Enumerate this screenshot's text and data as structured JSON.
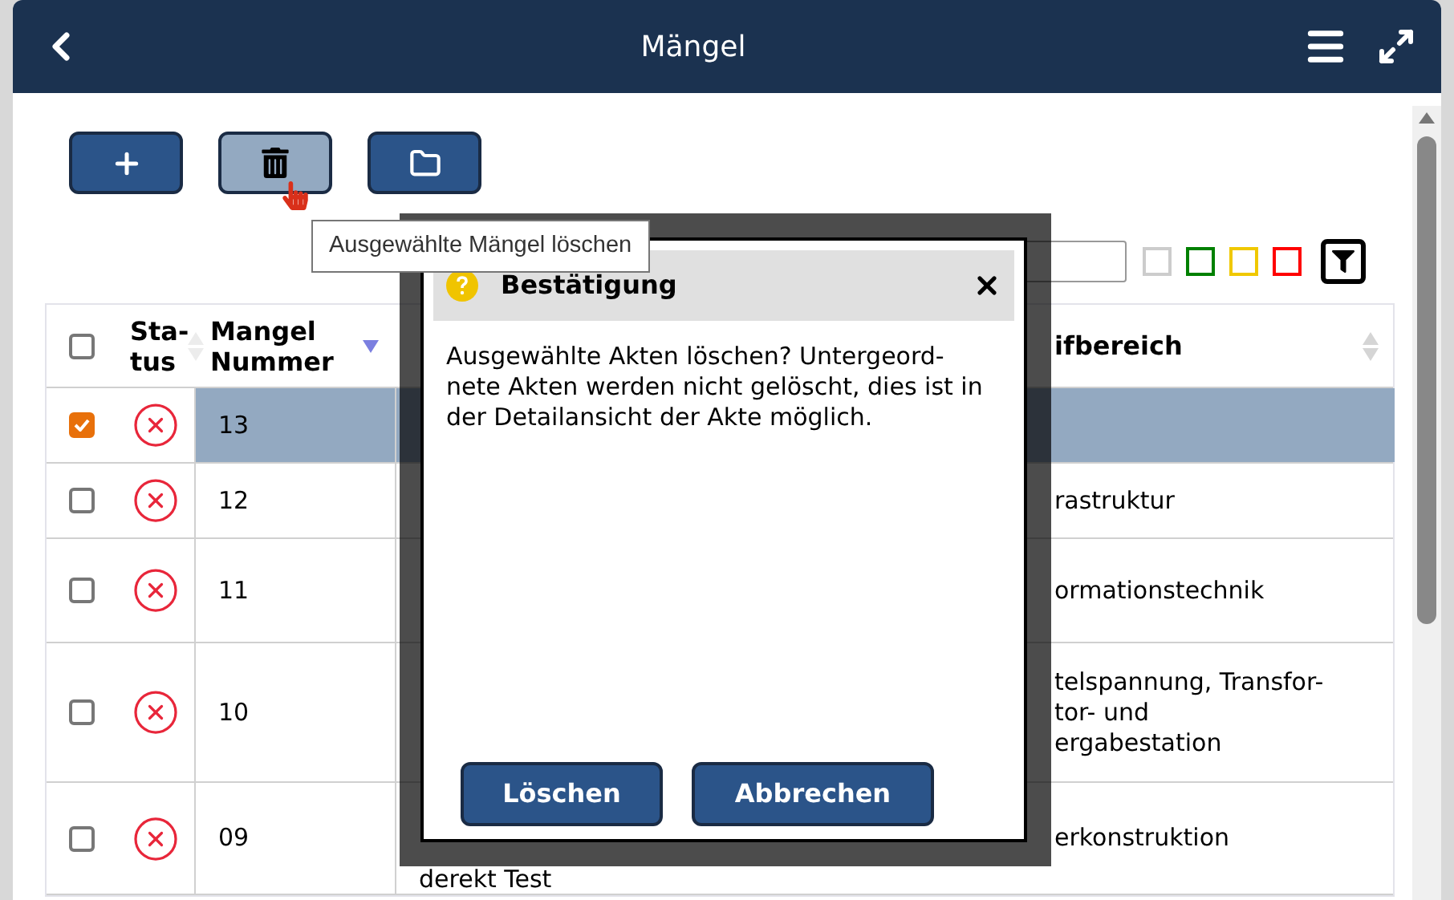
{
  "header": {
    "title": "Mängel"
  },
  "toolbar": {
    "buttons": [
      {
        "kind": "add",
        "hovered": false
      },
      {
        "kind": "delete",
        "hovered": true
      },
      {
        "kind": "folder",
        "hovered": false
      }
    ]
  },
  "tooltip": {
    "text": "Ausgewählte Mängel löschen"
  },
  "status_filters": [
    {
      "color": "#cccccc"
    },
    {
      "color": "#008000"
    },
    {
      "color": "#f0c800"
    },
    {
      "color": "#ff0000"
    }
  ],
  "table": {
    "header_checked": false,
    "columns": [
      {
        "label": "Sta-tus",
        "sorted": false
      },
      {
        "label": "Mangel Nummer",
        "sorted": true
      },
      {
        "label": "ifbereich",
        "sorted": false
      }
    ],
    "rows": [
      {
        "selected": true,
        "checked": true,
        "status_ok": false,
        "number": "13"
      },
      {
        "selected": false,
        "checked": false,
        "status_ok": false,
        "number": "12",
        "column_4": "rastruktur"
      },
      {
        "selected": false,
        "checked": false,
        "status_ok": false,
        "number": "11",
        "column_4": "ormationstechnik"
      },
      {
        "selected": false,
        "checked": false,
        "status_ok": false,
        "number": "10",
        "column_4": "telspannung, Transfor-\ntor- und\nergabestation"
      },
      {
        "selected": false,
        "checked": false,
        "status_ok": false,
        "number": "09",
        "column_3": "derekt Test",
        "column_4": "erkonstruktion"
      }
    ]
  },
  "dialog": {
    "title": "Bestätigung",
    "message": "Ausgewählte Akten löschen? Untergeord-nete Akten werden nicht gelöscht, dies ist in der Detailansicht der Akte möglich.",
    "buttons": [
      "Löschen",
      "Abbrechen"
    ]
  }
}
